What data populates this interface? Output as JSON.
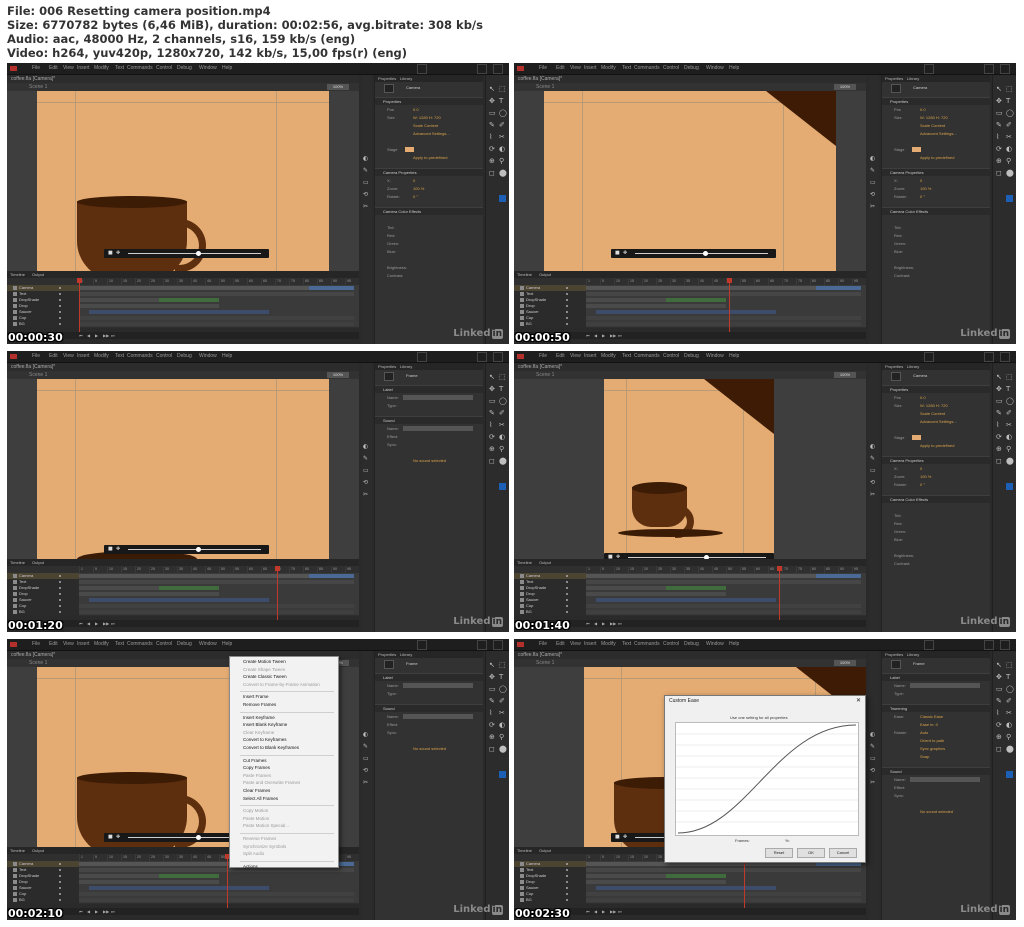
{
  "header": {
    "file": "File: 006 Resetting camera position.mp4",
    "size": "Size: 6770782 bytes (6,46 MiB), duration: 00:02:56, avg.bitrate: 308 kb/s",
    "audio": "Audio: aac, 48000 Hz, 2 channels, s16, 159 kb/s (eng)",
    "video": "Video: h264, yuv420p, 1280x720, 142 kb/s, 15,00 fps(r) (eng)"
  },
  "app": {
    "menu": [
      "File",
      "Edit",
      "View",
      "Insert",
      "Modify",
      "Text",
      "Commands",
      "Control",
      "Debug",
      "Window",
      "Help"
    ],
    "document_tab": "coffee.fla [Camera]*",
    "scene": "Scene 1",
    "timeline_tabs": [
      "Timeline",
      "Output"
    ],
    "layers": [
      "Camera",
      "Text",
      "DropShade",
      "Drop",
      "Saucer",
      "Cup",
      "BG"
    ],
    "ruler_numbers": [
      "1",
      "5",
      "10",
      "15",
      "20",
      "25",
      "30",
      "35",
      "40",
      "45",
      "50",
      "55",
      "60",
      "65",
      "70",
      "75",
      "80",
      "85",
      "90",
      "95"
    ],
    "watermark_left": "Linked",
    "watermark_right": "in",
    "colors": {
      "stage": "#e4ab72",
      "cup": "#5e2f0e",
      "chrome": "#2a2a2a",
      "tween_blue": "#4a6a95",
      "tween_green": "#3f6b3d",
      "playhead": "#c0392b"
    }
  },
  "frames": [
    {
      "timecode": "00:00:30",
      "panel_tabs": [
        "Properties",
        "Library"
      ],
      "panel_type": "Camera",
      "sections": [
        {
          "title": "Properties",
          "lines": [
            {
              "label": "Pos",
              "value": "0.0"
            },
            {
              "label": "Size",
              "value": "W: 1280   H: 720"
            },
            {
              "label": "",
              "value": "Scale Content"
            },
            {
              "label": "",
              "value": "Advanced Settings..."
            },
            {
              "label": "",
              "value": ""
            },
            {
              "label": "Stage",
              "value": ""
            },
            {
              "label": "",
              "value": "Apply to predefined"
            }
          ]
        },
        {
          "title": "Camera Properties",
          "lines": [
            {
              "label": "X:",
              "value": "0"
            },
            {
              "label": "Zoom:",
              "value": "100 %"
            },
            {
              "label": "Rotate:",
              "value": "0 °"
            }
          ]
        },
        {
          "title": "Camera Color Effects",
          "lines": [
            {
              "label": "",
              "value": ""
            },
            {
              "label": "Tint:",
              "value": ""
            },
            {
              "label": "Red:",
              "value": ""
            },
            {
              "label": "Green:",
              "value": ""
            },
            {
              "label": "Blue:",
              "value": ""
            },
            {
              "label": "",
              "value": ""
            },
            {
              "label": "Brightness:",
              "value": ""
            },
            {
              "label": "Contrast:",
              "value": ""
            }
          ]
        }
      ]
    },
    {
      "timecode": "00:00:50",
      "panel_tabs": [
        "Properties",
        "Library"
      ],
      "panel_type": "Camera",
      "sections": [
        {
          "title": "Properties",
          "lines": [
            {
              "label": "Pos",
              "value": "0.0"
            },
            {
              "label": "Size",
              "value": "W: 1280   H: 720"
            },
            {
              "label": "",
              "value": "Scale Content"
            },
            {
              "label": "",
              "value": "Advanced Settings..."
            },
            {
              "label": "",
              "value": ""
            },
            {
              "label": "Stage",
              "value": ""
            },
            {
              "label": "",
              "value": "Apply to predefined"
            }
          ]
        },
        {
          "title": "Camera Properties",
          "lines": [
            {
              "label": "X:",
              "value": "0"
            },
            {
              "label": "Zoom:",
              "value": "100 %"
            },
            {
              "label": "Rotate:",
              "value": "0 °"
            }
          ]
        },
        {
          "title": "Camera Color Effects",
          "lines": [
            {
              "label": "",
              "value": ""
            },
            {
              "label": "Tint:",
              "value": ""
            },
            {
              "label": "Red:",
              "value": ""
            },
            {
              "label": "Green:",
              "value": ""
            },
            {
              "label": "Blue:",
              "value": ""
            },
            {
              "label": "",
              "value": ""
            },
            {
              "label": "Brightness:",
              "value": ""
            },
            {
              "label": "Contrast:",
              "value": ""
            }
          ]
        }
      ]
    },
    {
      "timecode": "00:01:20",
      "panel_tabs": [
        "Properties",
        "Library"
      ],
      "panel_type": "Frame",
      "sections": [
        {
          "title": "Label",
          "lines": [
            {
              "label": "Name:",
              "value": ""
            },
            {
              "label": "Type:",
              "value": ""
            }
          ]
        },
        {
          "title": "Sound",
          "lines": [
            {
              "label": "Name:",
              "value": "None"
            },
            {
              "label": "Effect:",
              "value": ""
            },
            {
              "label": "Sync:",
              "value": ""
            },
            {
              "label": "",
              "value": ""
            },
            {
              "label": "",
              "value": "No sound selected"
            }
          ]
        }
      ]
    },
    {
      "timecode": "00:01:40",
      "panel_tabs": [
        "Properties",
        "Library"
      ],
      "panel_type": "Camera",
      "sections": [
        {
          "title": "Properties",
          "lines": [
            {
              "label": "Pos",
              "value": "0.0"
            },
            {
              "label": "Size",
              "value": "W: 1280   H: 720"
            },
            {
              "label": "",
              "value": "Scale Content"
            },
            {
              "label": "",
              "value": "Advanced Settings..."
            },
            {
              "label": "",
              "value": ""
            },
            {
              "label": "Stage",
              "value": ""
            },
            {
              "label": "",
              "value": "Apply to predefined"
            }
          ]
        },
        {
          "title": "Camera Properties",
          "lines": [
            {
              "label": "X:",
              "value": "0"
            },
            {
              "label": "Zoom:",
              "value": "100 %"
            },
            {
              "label": "Rotate:",
              "value": "0 °"
            }
          ]
        },
        {
          "title": "Camera Color Effects",
          "lines": [
            {
              "label": "",
              "value": ""
            },
            {
              "label": "Tint:",
              "value": ""
            },
            {
              "label": "Red:",
              "value": ""
            },
            {
              "label": "Green:",
              "value": ""
            },
            {
              "label": "Blue:",
              "value": ""
            },
            {
              "label": "",
              "value": ""
            },
            {
              "label": "Brightness:",
              "value": ""
            },
            {
              "label": "Contrast:",
              "value": ""
            }
          ]
        }
      ]
    },
    {
      "timecode": "00:02:10",
      "panel_tabs": [
        "Properties",
        "Library"
      ],
      "panel_type": "Frame",
      "sections": [
        {
          "title": "Label",
          "lines": [
            {
              "label": "Name:",
              "value": ""
            },
            {
              "label": "Type:",
              "value": ""
            }
          ]
        },
        {
          "title": "Sound",
          "lines": [
            {
              "label": "Name:",
              "value": "None"
            },
            {
              "label": "Effect:",
              "value": ""
            },
            {
              "label": "Sync:",
              "value": ""
            },
            {
              "label": "",
              "value": ""
            },
            {
              "label": "",
              "value": "No sound selected"
            }
          ]
        }
      ],
      "context_menu": [
        {
          "label": "Create Motion Tween",
          "disabled": false
        },
        {
          "label": "Create Shape Tween",
          "disabled": true
        },
        {
          "label": "Create Classic Tween",
          "disabled": false
        },
        {
          "label": "Convert to Frame-by-Frame Animation",
          "disabled": true
        },
        {
          "sep": true
        },
        {
          "label": "Insert Frame",
          "disabled": false
        },
        {
          "label": "Remove Frames",
          "disabled": false
        },
        {
          "sep": true
        },
        {
          "label": "Insert Keyframe",
          "disabled": false
        },
        {
          "label": "Insert Blank Keyframe",
          "disabled": false
        },
        {
          "label": "Clear Keyframe",
          "disabled": true
        },
        {
          "label": "Convert to Keyframes",
          "disabled": false
        },
        {
          "label": "Convert to Blank Keyframes",
          "disabled": false
        },
        {
          "sep": true
        },
        {
          "label": "Cut Frames",
          "disabled": false
        },
        {
          "label": "Copy Frames",
          "disabled": false
        },
        {
          "label": "Paste Frames",
          "disabled": true
        },
        {
          "label": "Paste and Overwrite Frames",
          "disabled": true
        },
        {
          "label": "Clear Frames",
          "disabled": false
        },
        {
          "label": "Select All Frames",
          "disabled": false
        },
        {
          "sep": true
        },
        {
          "label": "Copy Motion",
          "disabled": true
        },
        {
          "label": "Paste Motion",
          "disabled": true
        },
        {
          "label": "Paste Motion Special...",
          "disabled": true
        },
        {
          "sep": true
        },
        {
          "label": "Reverse Frames",
          "disabled": true
        },
        {
          "label": "Synchronize Symbols",
          "disabled": true
        },
        {
          "label": "Split Audio",
          "disabled": true
        },
        {
          "sep": true
        },
        {
          "label": "Actions",
          "disabled": false
        }
      ]
    },
    {
      "timecode": "00:02:30",
      "panel_tabs": [
        "Properties",
        "Library"
      ],
      "panel_type": "Frame",
      "sections": [
        {
          "title": "Label",
          "lines": [
            {
              "label": "Name:",
              "value": ""
            },
            {
              "label": "Type:",
              "value": ""
            }
          ]
        },
        {
          "title": "Tweening",
          "lines": [
            {
              "label": "Ease:",
              "value": "Classic Ease"
            },
            {
              "label": "",
              "value": "Ease in: 0"
            },
            {
              "label": "Rotate:",
              "value": "Auto"
            },
            {
              "label": "",
              "value": "Orient to path"
            },
            {
              "label": "",
              "value": "Sync graphics"
            },
            {
              "label": "",
              "value": "Snap"
            }
          ]
        },
        {
          "title": "Sound",
          "lines": [
            {
              "label": "Name:",
              "value": "None"
            },
            {
              "label": "Effect:",
              "value": ""
            },
            {
              "label": "Sync:",
              "value": ""
            },
            {
              "label": "",
              "value": ""
            },
            {
              "label": "",
              "value": "No sound selected"
            }
          ]
        }
      ],
      "dialog": {
        "title": "Custom Ease",
        "checkbox": "Use one setting for all properties",
        "x_label": "Frames:",
        "pct_label": "%:",
        "buttons": [
          "Reset",
          "OK",
          "Cancel"
        ]
      }
    }
  ]
}
